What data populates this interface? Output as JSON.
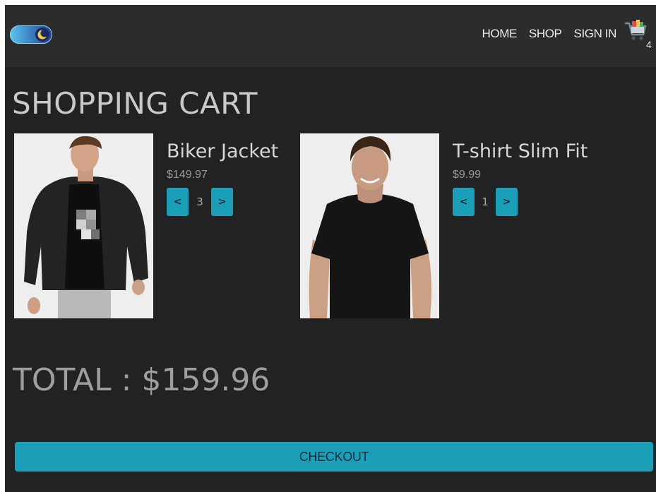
{
  "nav": {
    "links": [
      "HOME",
      "SHOP",
      "SIGN IN"
    ],
    "cart_count": "4"
  },
  "icons": {
    "theme_toggle": "theme-toggle-icon",
    "cart": "shopping-cart-icon"
  },
  "page": {
    "title": "SHOPPING CART"
  },
  "cart": {
    "items": [
      {
        "name": "Biker Jacket",
        "price": "$149.97",
        "quantity": "3",
        "decrement": "<",
        "increment": ">"
      },
      {
        "name": "T-shirt Slim Fit",
        "price": "$9.99",
        "quantity": "1",
        "decrement": "<",
        "increment": ">"
      }
    ],
    "total": "TOTAL : $159.96"
  },
  "checkout_label": "CHECKOUT",
  "colors": {
    "accent": "#1a9fb8",
    "background": "#222222",
    "header": "#2c2c2c"
  }
}
